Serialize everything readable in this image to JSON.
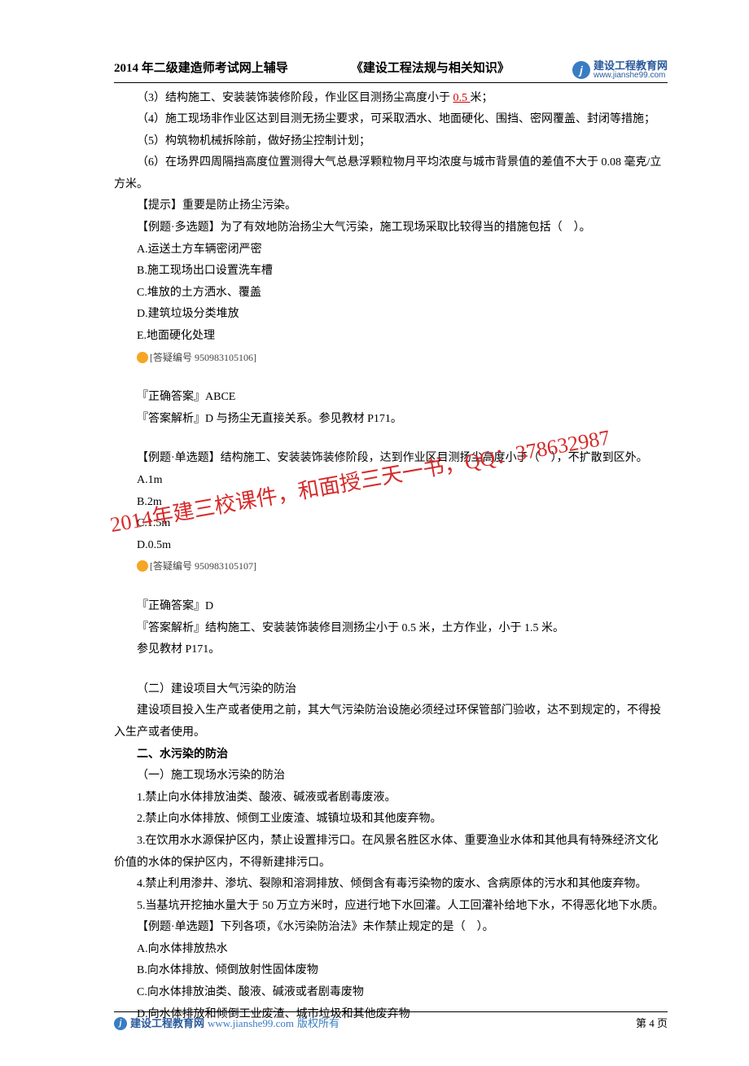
{
  "header": {
    "course": "2014 年二级建造师考试网上辅导",
    "subject": "《建设工程法规与相关知识》",
    "logo_text_top": "建设工程教育网",
    "logo_text_bottom": "www.jianshe99.com",
    "logo_letter": "j"
  },
  "body": {
    "p01a": "（3）结构施工、安装装饰装修阶段，作业区目测扬尘高度小于 ",
    "p01b": "0.5 ",
    "p01c": "米；",
    "p02": "（4）施工现场非作业区达到目测无扬尘要求，可采取洒水、地面硬化、围挡、密网覆盖、封闭等措施；",
    "p03": "（5）构筑物机械拆除前，做好扬尘控制计划；",
    "p04": "（6）在场界四周隔挡高度位置测得大气总悬浮颗粒物月平均浓度与城市背景值的差值不大于 0.08 毫克/立方米。",
    "p05": "【提示】重要是防止扬尘污染。",
    "p06": "【例题·多选题】为了有效地防治扬尘大气污染，施工现场采取比较得当的措施包括（　）。",
    "p07": "A.运送土方车辆密闭严密",
    "p08": "B.施工现场出口设置洗车槽",
    "p09": "C.堆放的土方洒水、覆盖",
    "p10": "D.建筑垃圾分类堆放",
    "p11": "E.地面硬化处理",
    "q1_icon": "?",
    "q1_label": "[答疑编号 950983105106]",
    "p12": "『正确答案』ABCE",
    "p13": "『答案解析』D 与扬尘无直接关系。参见教材 P171。",
    "p14": "【例题·单选题】结构施工、安装装饰装修阶段，达到作业区目测扬尘高度小于（　），不扩散到区外。",
    "p15": "A.1m",
    "p16": "B.2m",
    "p17": "C.1.5m",
    "p18": "D.0.5m",
    "q2_icon": "?",
    "q2_label": "[答疑编号 950983105107]",
    "p19": "『正确答案』D",
    "p20": "『答案解析』结构施工、安装装饰装修目测扬尘小于 0.5 米，土方作业，小于 1.5 米。",
    "p21": "参见教材 P171。",
    "p22": "（二）建设项目大气污染的防治",
    "p23": "建设项目投入生产或者使用之前，其大气污染防治设施必须经过环保管部门验收，达不到规定的，不得投入生产或者使用。",
    "p24": "二、水污染的防治",
    "p25": "（一）施工现场水污染的防治",
    "p26": "1.禁止向水体排放油类、酸液、碱液或者剧毒废液。",
    "p27": "2.禁止向水体排放、倾倒工业废渣、城镇垃圾和其他废弃物。",
    "p28": "3.在饮用水水源保护区内，禁止设置排污口。在风景名胜区水体、重要渔业水体和其他具有特殊经济文化价值的水体的保护区内，不得新建排污口。",
    "p29": "4.禁止利用渗井、渗坑、裂隙和溶洞排放、倾倒含有毒污染物的废水、含病原体的污水和其他废弃物。",
    "p30": "5.当基坑开挖抽水量大于 50 万立方米时，应进行地下水回灌。人工回灌补给地下水，不得恶化地下水质。",
    "p31": "【例题·单选题】下列各项，《水污染防治法》未作禁止规定的是（　）。",
    "p32": "A.向水体排放热水",
    "p33": "B.向水体排放、倾倒放射性固体废物",
    "p34": "C.向水体排放油类、酸液、碱液或者剧毒废物",
    "p35": "D.向水体排放和倾倒工业废渣、城市垃圾和其他废弃物"
  },
  "watermark": "2014年建三校课件，和面授三天一书，QQ：378632987",
  "footer": {
    "logo_letter": "j",
    "brand": "建设工程教育网",
    "url": "www.jianshe99.com",
    "copyright": "版权所有",
    "page": "第 4 页"
  }
}
